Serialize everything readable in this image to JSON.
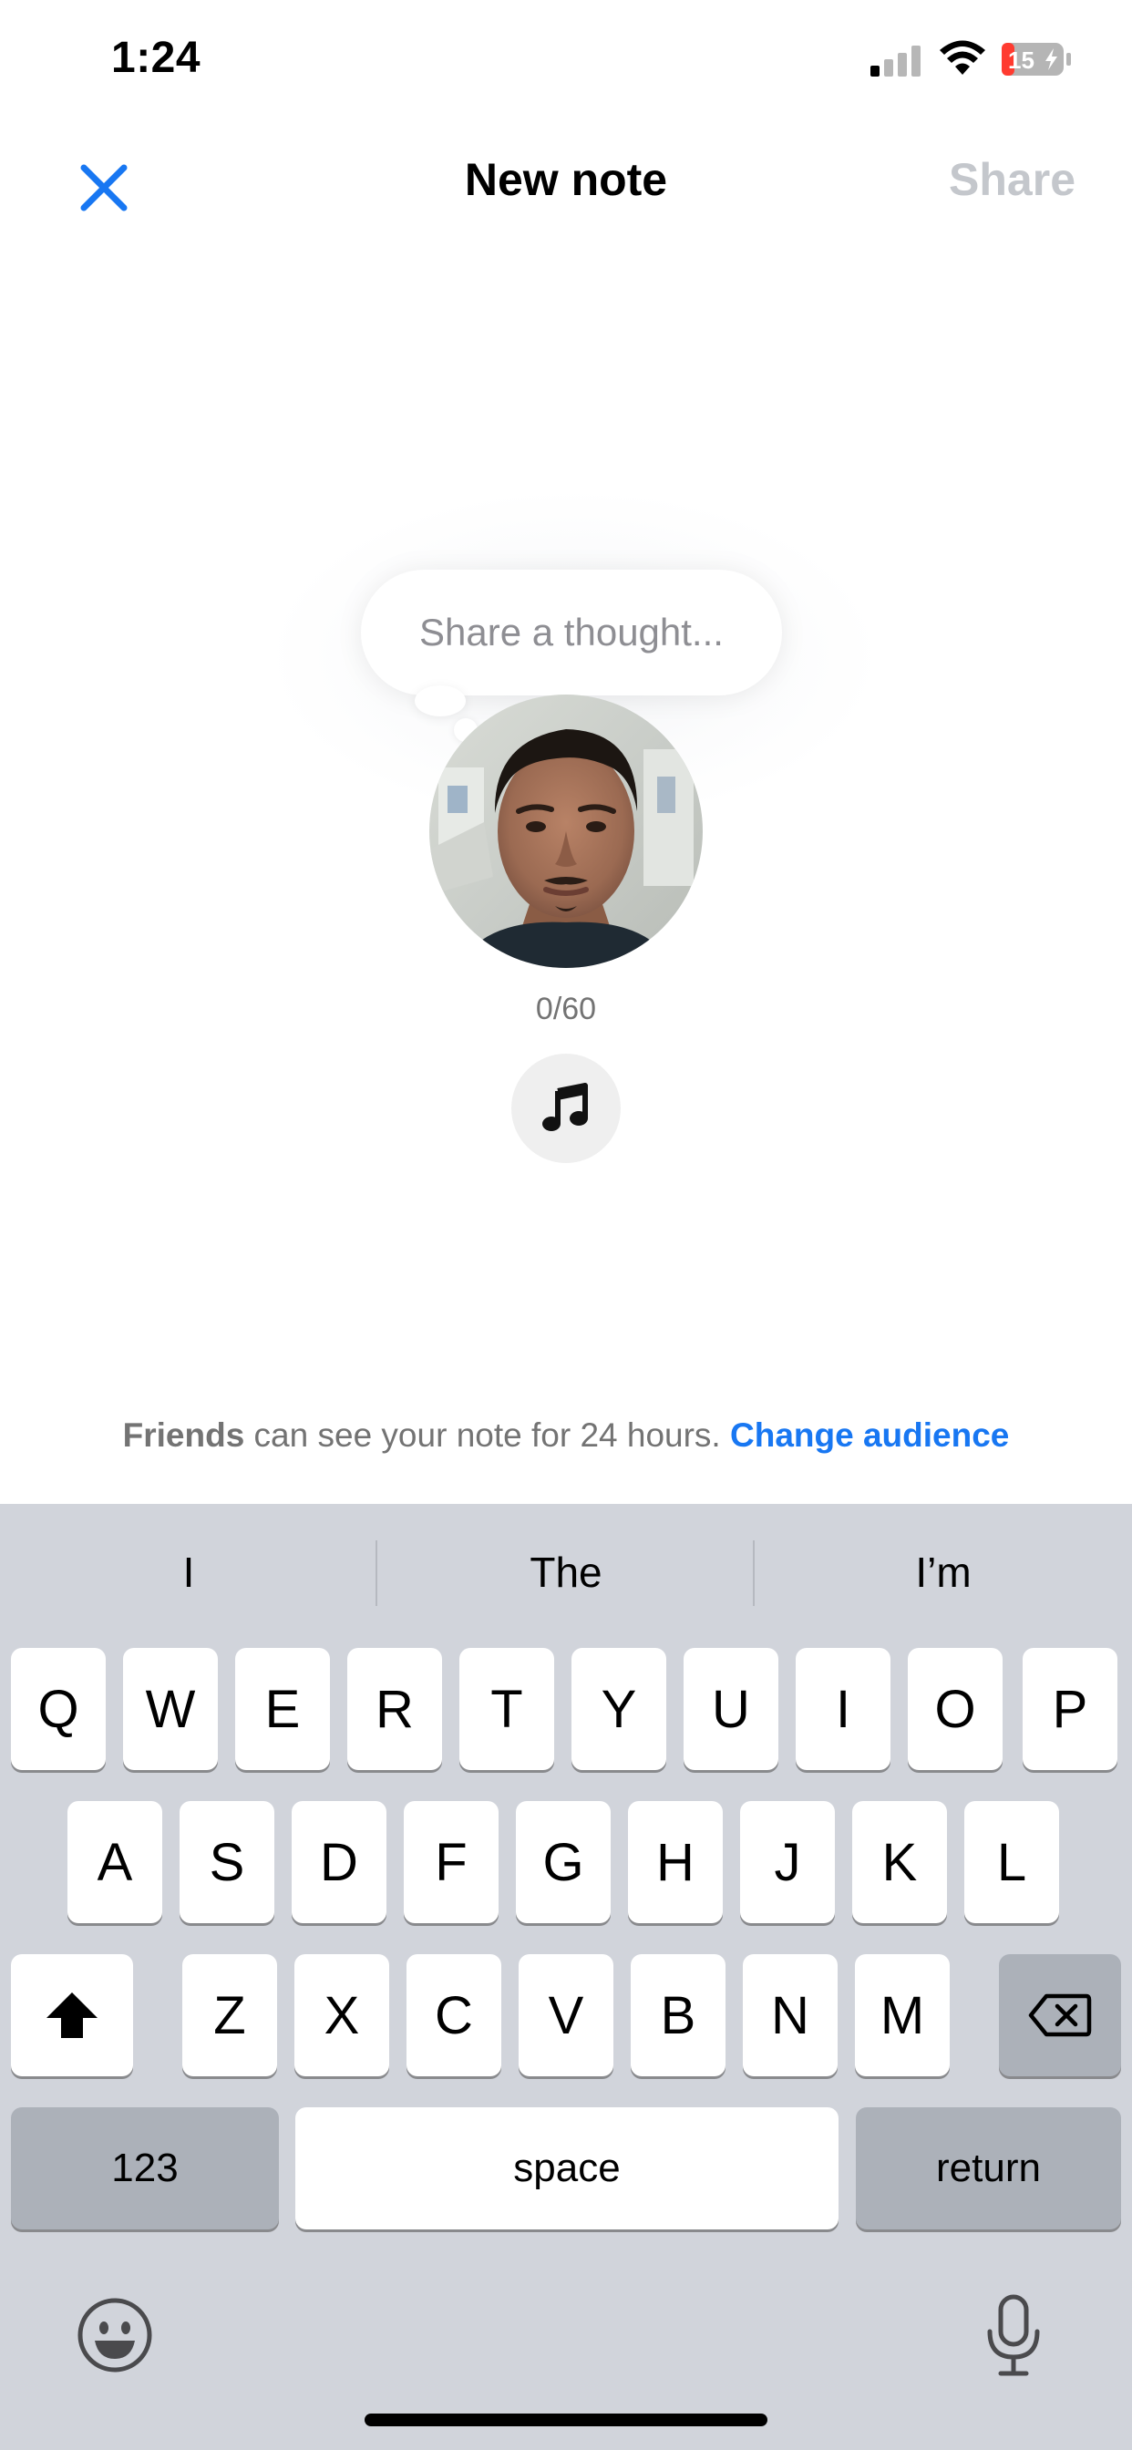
{
  "status_bar": {
    "time": "1:24",
    "battery_level": "15"
  },
  "header": {
    "title": "New note",
    "share_label": "Share",
    "close_icon": "close-icon",
    "accent_color": "#1877f2",
    "share_disabled_color": "#c4c7cc"
  },
  "composer": {
    "placeholder": "Share a thought...",
    "char_count": "0/60",
    "music_icon": "music-note-icon"
  },
  "audience": {
    "bold": "Friends",
    "text": " can see your note for 24 hours. ",
    "link": "Change audience"
  },
  "keyboard": {
    "suggestions": [
      "I",
      "The",
      "I’m"
    ],
    "row1": [
      "Q",
      "W",
      "E",
      "R",
      "T",
      "Y",
      "U",
      "I",
      "O",
      "P"
    ],
    "row2": [
      "A",
      "S",
      "D",
      "F",
      "G",
      "H",
      "J",
      "K",
      "L"
    ],
    "row3": [
      "Z",
      "X",
      "C",
      "V",
      "B",
      "N",
      "M"
    ],
    "numbers_label": "123",
    "space_label": "space",
    "return_label": "return",
    "shift_icon": "shift-icon",
    "delete_icon": "backspace-icon",
    "emoji_icon": "emoji-icon",
    "mic_icon": "microphone-icon"
  }
}
